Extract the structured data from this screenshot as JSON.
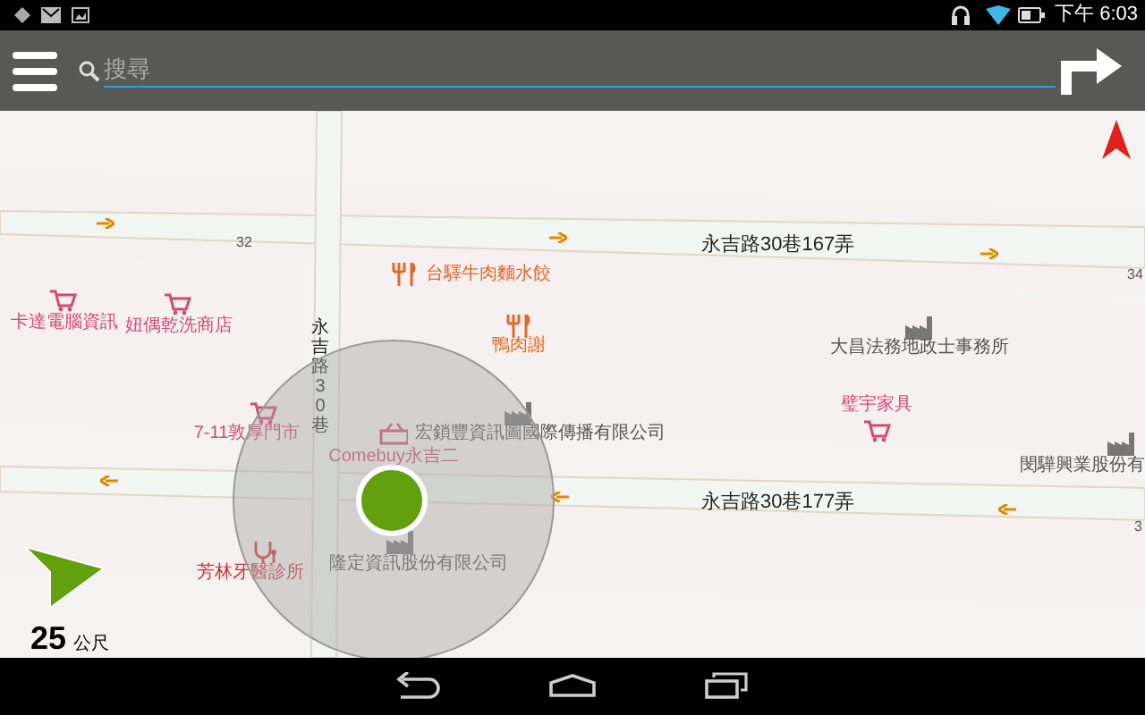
{
  "status_bar": {
    "time": "下午 6:03"
  },
  "search": {
    "placeholder": "搜尋"
  },
  "map": {
    "streets": [
      {
        "name": "永吉路30巷167弄",
        "kind": "horizontal"
      },
      {
        "name": "永吉路30巷177弄",
        "kind": "horizontal"
      },
      {
        "name": "永吉路30巷",
        "kind": "vertical"
      }
    ],
    "road_numbers": [
      "32",
      "34",
      "3"
    ],
    "pois": [
      {
        "name": "卡達電腦資訊",
        "kind": "shop"
      },
      {
        "name": "妞偶乾洗商店",
        "kind": "shop"
      },
      {
        "name": "台驛牛肉麵水餃",
        "kind": "restaurant"
      },
      {
        "name": "鴨肉謝",
        "kind": "restaurant"
      },
      {
        "name": "7-11敦厚門市",
        "kind": "shop"
      },
      {
        "name": "Comebuy永吉二",
        "kind": "basket"
      },
      {
        "name": "宏鎖豐資訊圖國際傳播有限公司",
        "kind": "company"
      },
      {
        "name": "大昌法務地政士事務所",
        "kind": "company"
      },
      {
        "name": "璧宇家具",
        "kind": "shop"
      },
      {
        "name": "閔驊興業股份有",
        "kind": "company"
      },
      {
        "name": "芳林牙醫診所",
        "kind": "clinic"
      },
      {
        "name": "隆定資訊股份有限公司",
        "kind": "company"
      }
    ],
    "one_way_arrows": [
      {
        "kind": "right"
      },
      {
        "kind": "right"
      },
      {
        "kind": "right"
      },
      {
        "kind": "left"
      },
      {
        "kind": "left"
      },
      {
        "kind": "left"
      }
    ]
  },
  "scale": {
    "value": "25",
    "unit": "公尺"
  }
}
